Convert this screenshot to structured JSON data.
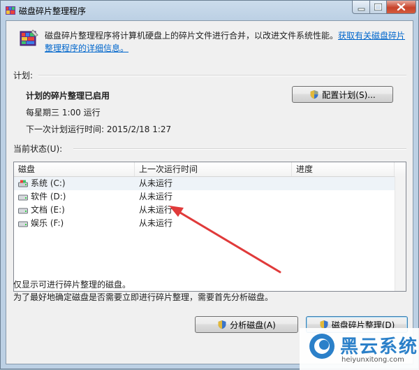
{
  "window": {
    "title": "磁盘碎片整理程序"
  },
  "header": {
    "description": "磁盘碎片整理程序将计算机硬盘上的碎片文件进行合并，以改进文件系统性能。",
    "help_link": "获取有关磁盘碎片整理程序的详细信息。"
  },
  "schedule": {
    "group_label": "计划:",
    "status": "计划的碎片整理已启用",
    "time": "每星期三  1:00 运行",
    "next_run": "下一次计划运行时间: 2015/2/18 1:27",
    "configure_button": "配置计划(S)..."
  },
  "current_status": {
    "group_label": "当前状态(U):",
    "columns": [
      "磁盘",
      "上一次运行时间",
      "进度"
    ],
    "rows": [
      {
        "disk": "系统 (C:)",
        "last_run": "从未运行",
        "progress": "",
        "icon": "system-drive-icon"
      },
      {
        "disk": "软件 (D:)",
        "last_run": "从未运行",
        "progress": "",
        "icon": "hard-drive-icon"
      },
      {
        "disk": "文档 (E:)",
        "last_run": "从未运行",
        "progress": "",
        "icon": "hard-drive-icon"
      },
      {
        "disk": "娱乐 (F:)",
        "last_run": "从未运行",
        "progress": "",
        "icon": "hard-drive-icon"
      }
    ]
  },
  "footer": {
    "note1": "仅显示可进行碎片整理的磁盘。",
    "note2": "为了最好地确定磁盘是否需要立即进行碎片整理，需要首先分析磁盘。",
    "analyze_button": "分析磁盘(A)",
    "defrag_button": "磁盘碎片整理(D)"
  },
  "watermark": {
    "title": "黑云系统",
    "url": "heiyunxitong.com"
  },
  "colors": {
    "link": "#0066cc",
    "arrow": "#e03a3a",
    "watermark": "#2b80c9"
  }
}
